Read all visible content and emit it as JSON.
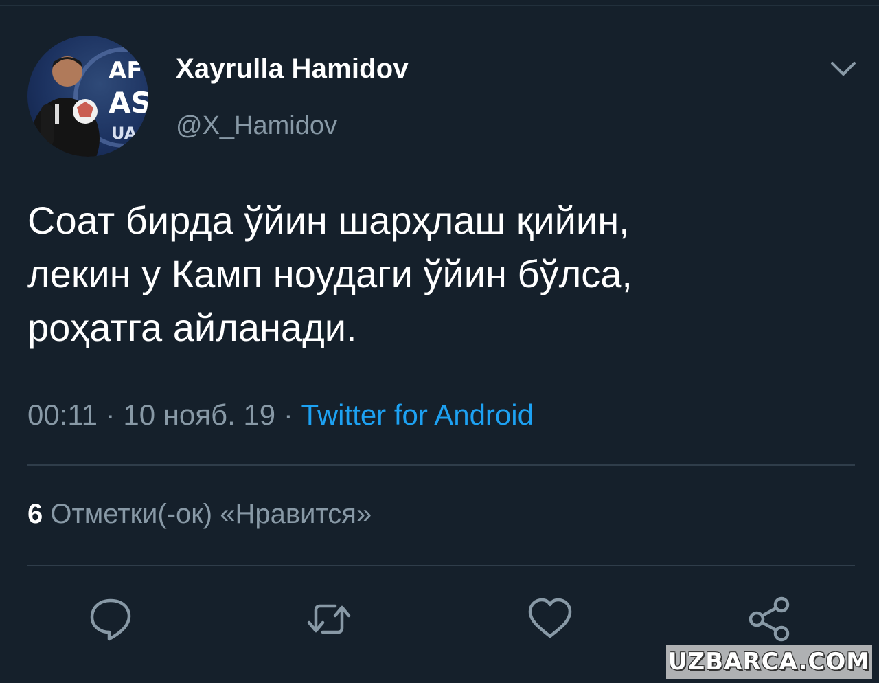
{
  "user": {
    "display_name": "Xayrulla Hamidov",
    "handle": "@X_Hamidov"
  },
  "tweet": {
    "lines": [
      "Соат бирда ўйин шарҳлаш қийин,",
      "лекин у Камп ноудаги ўйин бўлса,",
      "роҳатга айланади."
    ],
    "time": "00:11",
    "separator": "·",
    "date": "10 нояб. 19",
    "source": "Twitter for Android"
  },
  "stats": {
    "likes_count": "6",
    "likes_label": "Отметки(-ок) «Нравится»"
  },
  "avatar_text": {
    "line1": "AF",
    "line2": "AS",
    "line3": "UA"
  },
  "watermark": "UZBARCA.COM",
  "icons": {
    "menu": "chevron-down-icon",
    "reply": "speech-bubble-icon",
    "retweet": "retweet-arrows-icon",
    "like": "heart-icon",
    "share": "share-nodes-icon"
  },
  "colors": {
    "background": "#15202b",
    "secondary_text": "#8899a6",
    "link": "#1da1f2",
    "divider": "#2f3d4a"
  }
}
